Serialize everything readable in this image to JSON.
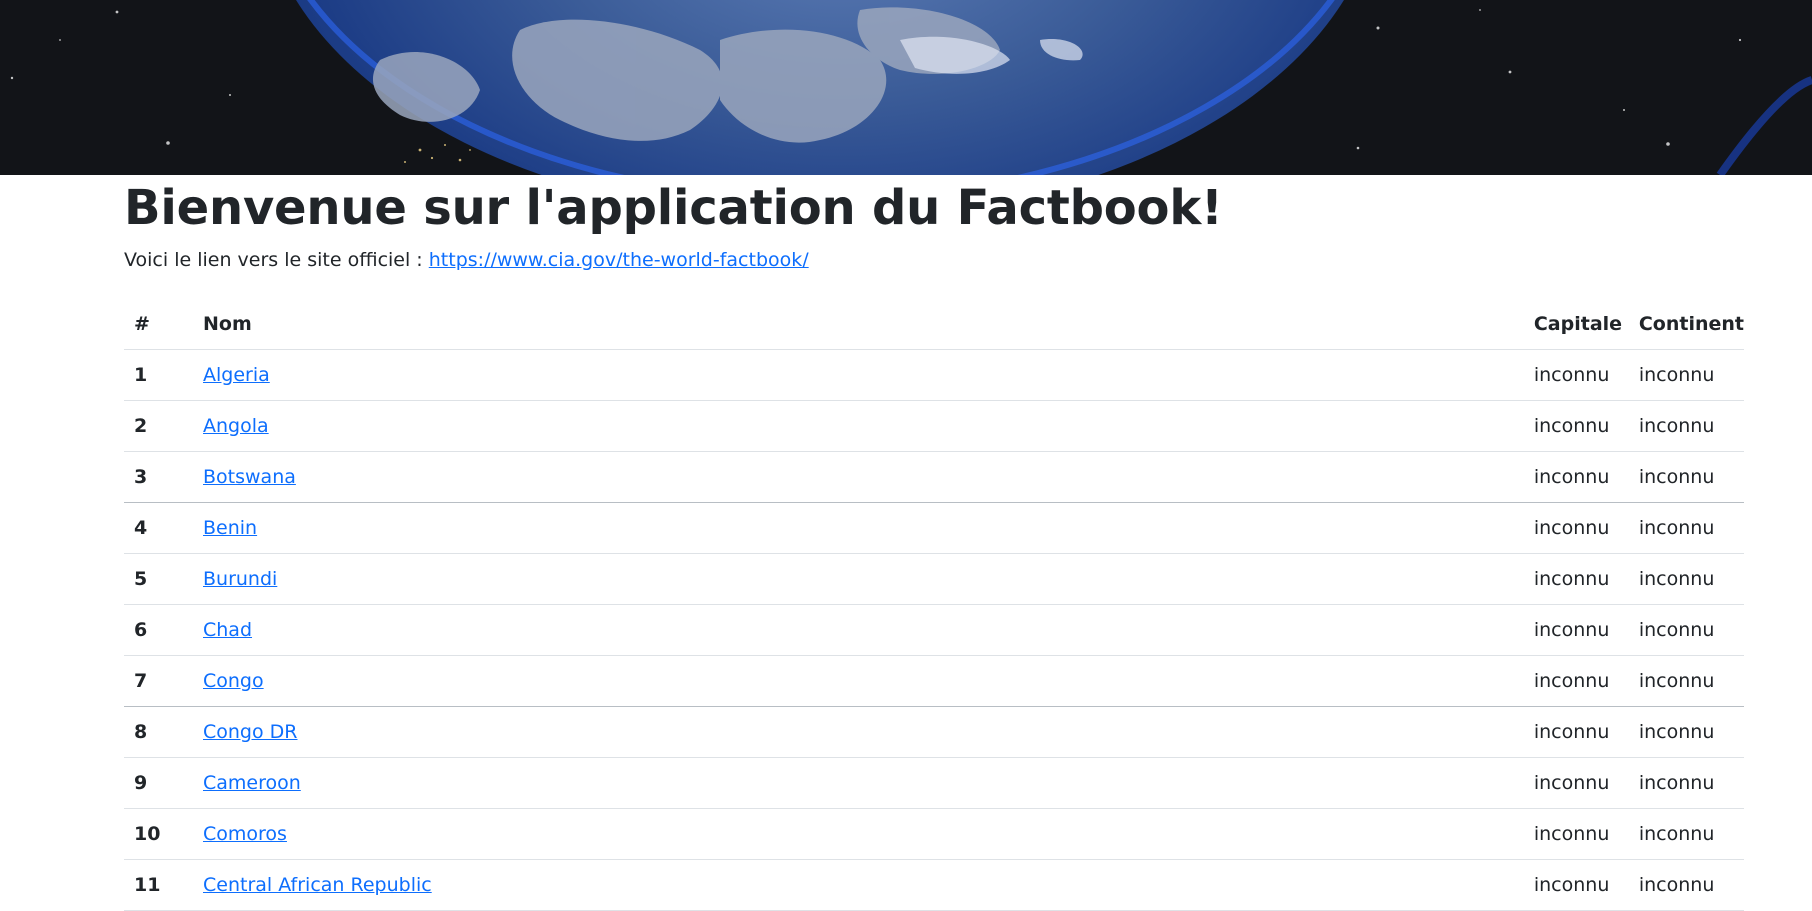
{
  "banner": {
    "image_name": "earth-from-space-image"
  },
  "page": {
    "title": "Bienvenue sur l'application du Factbook!",
    "intro_text": "Voici le lien vers le site officiel : ",
    "official_link": "https://www.cia.gov/the-world-factbook/"
  },
  "table": {
    "headers": [
      "#",
      "Nom",
      "Capitale",
      "Continent"
    ],
    "rows": [
      {
        "num": "1",
        "name": "Algeria",
        "capital": "inconnu",
        "continent": "inconnu"
      },
      {
        "num": "2",
        "name": "Angola",
        "capital": "inconnu",
        "continent": "inconnu"
      },
      {
        "num": "3",
        "name": "Botswana",
        "capital": "inconnu",
        "continent": "inconnu"
      },
      {
        "num": "4",
        "name": "Benin",
        "capital": "inconnu",
        "continent": "inconnu"
      },
      {
        "num": "5",
        "name": "Burundi",
        "capital": "inconnu",
        "continent": "inconnu"
      },
      {
        "num": "6",
        "name": "Chad",
        "capital": "inconnu",
        "continent": "inconnu"
      },
      {
        "num": "7",
        "name": "Congo",
        "capital": "inconnu",
        "continent": "inconnu"
      },
      {
        "num": "8",
        "name": "Congo DR",
        "capital": "inconnu",
        "continent": "inconnu"
      },
      {
        "num": "9",
        "name": "Cameroon",
        "capital": "inconnu",
        "continent": "inconnu"
      },
      {
        "num": "10",
        "name": "Comoros",
        "capital": "inconnu",
        "continent": "inconnu"
      },
      {
        "num": "11",
        "name": "Central African Republic",
        "capital": "inconnu",
        "continent": "inconnu"
      }
    ]
  },
  "colors": {
    "link": "#0d6efd",
    "text": "#212529",
    "border": "#dee2e6",
    "banner_bg": "#121418"
  }
}
